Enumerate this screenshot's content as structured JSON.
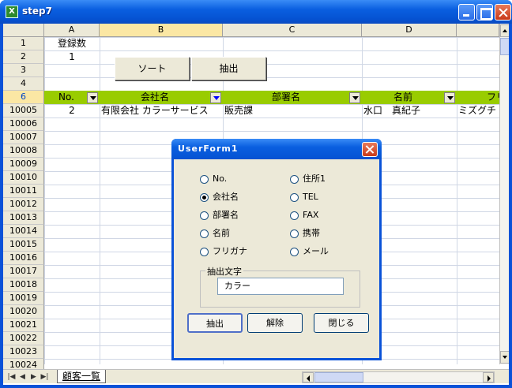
{
  "window": {
    "title": "step7",
    "app_icon_text": "X"
  },
  "columns": [
    "A",
    "B",
    "C",
    "D"
  ],
  "rows": [
    "1",
    "2",
    "3",
    "4",
    "6",
    "10005",
    "10006",
    "10007",
    "10008",
    "10009",
    "10010",
    "10011",
    "10012",
    "10013",
    "10014",
    "10015",
    "10016",
    "10017",
    "10018",
    "10019",
    "10020",
    "10021",
    "10022",
    "10023",
    "10024"
  ],
  "cells": {
    "a1": "登録数",
    "a2": "1",
    "row6": {
      "no": "2",
      "company": "有限会社 カラーサービス",
      "dept": "販売課",
      "name": "水口　真紀子",
      "kana": "ミズグチ"
    }
  },
  "sheet_buttons": {
    "sort": "ソート",
    "extract": "抽出"
  },
  "header_row": {
    "no": "No.",
    "company": "会社名",
    "dept": "部署名",
    "name": "名前",
    "kana": "フリ"
  },
  "sheet_tab": "顧客一覧",
  "nav_buttons": [
    "|◀",
    "◀",
    "▶",
    "▶|"
  ],
  "dialog": {
    "title": "UserForm1",
    "options_left": [
      "No.",
      "会社名",
      "部署名",
      "名前",
      "フリガナ"
    ],
    "options_right": [
      "住所1",
      "TEL",
      "FAX",
      "携帯",
      "メール"
    ],
    "selected_option": "会社名",
    "group_label": "抽出文字",
    "filter_value": "カラー",
    "buttons": {
      "extract": "抽出",
      "release": "解除",
      "close": "閉じる"
    }
  },
  "colors": {
    "header_band": "#99cc00",
    "title_blue": "#0a52d8",
    "selection": "#fbe7a4"
  }
}
